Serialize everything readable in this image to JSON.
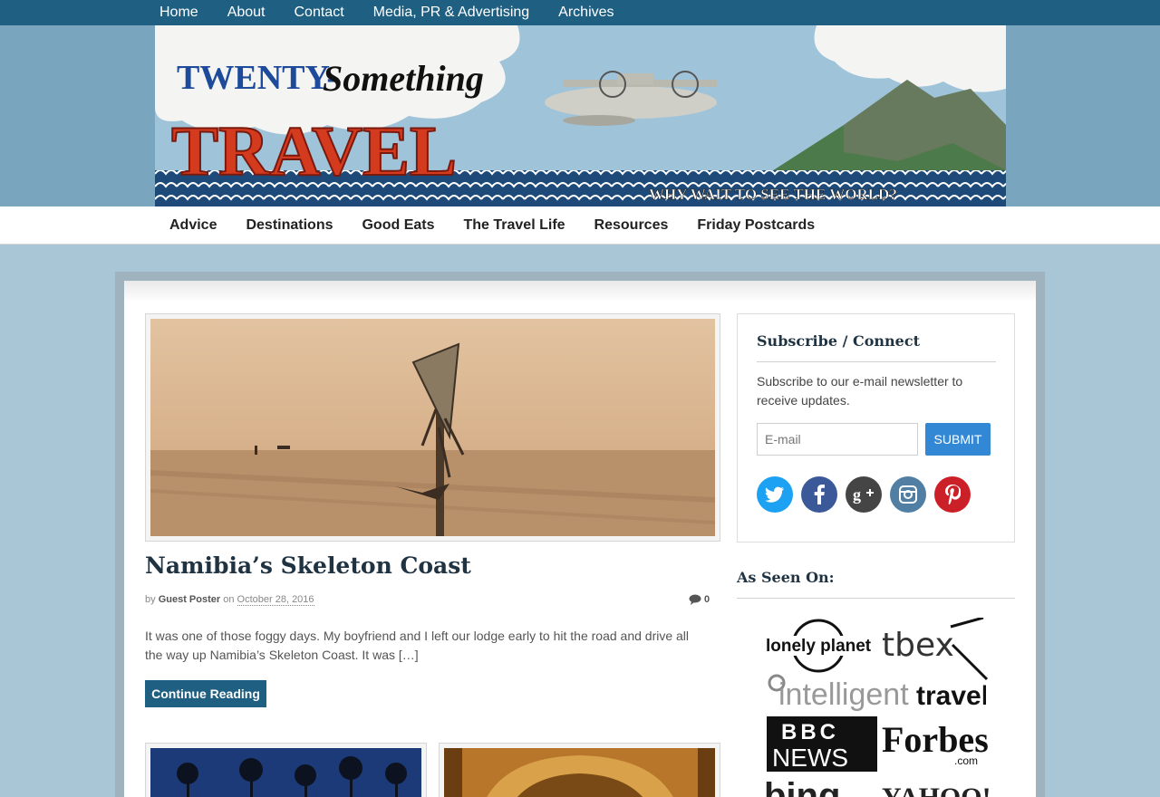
{
  "top_nav": [
    "Home",
    "About",
    "Contact",
    "Media, PR & Advertising",
    "Archives"
  ],
  "banner": {
    "twenty": "TWENTY-",
    "something": "Something",
    "travel": "TRAVEL",
    "tagline": "WHY WAIT TO SEE THE WORLD?"
  },
  "main_nav": [
    "Advice",
    "Destinations",
    "Good Eats",
    "The Travel Life",
    "Resources",
    "Friday Postcards"
  ],
  "post": {
    "title": "Namibia’s Skeleton Coast",
    "by": "by",
    "author": "Guest Poster",
    "on": "on",
    "date": "October 28, 2016",
    "comments": "0",
    "excerpt": "It was one of those foggy days. My boyfriend and I left our lodge early to hit the road and drive all the way up Namibia’s Skeleton Coast. It was […]",
    "continue_label": "Continue Reading"
  },
  "subscribe": {
    "title": "Subscribe / Connect",
    "description": "Subscribe to our e-mail newsletter to receive updates.",
    "email_placeholder": "E-mail",
    "submit_label": "SUBMIT",
    "socials": [
      {
        "name": "twitter-icon",
        "color": "#1da1f2",
        "glyph": "t"
      },
      {
        "name": "facebook-icon",
        "color": "#3b5998",
        "glyph": "f"
      },
      {
        "name": "google-plus-icon",
        "color": "#454545",
        "glyph": "g+"
      },
      {
        "name": "instagram-icon",
        "color": "#517fa4",
        "glyph": "ig"
      },
      {
        "name": "pinterest-icon",
        "color": "#cb2027",
        "glyph": "p"
      }
    ]
  },
  "as_seen_on": {
    "title": "As Seen On:",
    "logos": {
      "lonely_planet": "lonely planet",
      "tbex": "tbex",
      "intelligent": "intelligent",
      "travel": "travel",
      "bbc": "BBC",
      "news": "NEWS",
      "forbes": "Forbes",
      "forbes_com": ".com",
      "bing": "bing",
      "yahoo": "YAHOO!"
    }
  },
  "colors": {
    "brand_blue": "#1e5f82",
    "submit_blue": "#3388d6",
    "title_navy": "#1f3342"
  }
}
